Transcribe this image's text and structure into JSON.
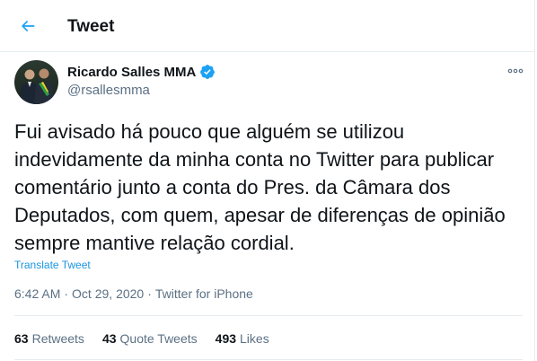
{
  "header": {
    "title": "Tweet",
    "back_icon": "arrow-left-icon"
  },
  "author": {
    "name": "Ricardo Salles MMA",
    "handle": "@rsallesmma",
    "verified_icon": "verified-badge-icon"
  },
  "tweet": {
    "text": "Fui avisado há pouco que alguém se utilizou indevidamente da minha conta no Twitter para publicar comentário junto a conta do Pres. da Câmara dos Deputados, com quem, apesar de diferenças de opinião sempre mantive relação cordial.",
    "translate": "Translate Tweet",
    "time": "6:42 AM",
    "date": "Oct 29, 2020",
    "separator": "·",
    "source": "Twitter for iPhone"
  },
  "stats": {
    "retweets_count": "63",
    "retweets_label": "Retweets",
    "quotes_count": "43",
    "quotes_label": "Quote Tweets",
    "likes_count": "493",
    "likes_label": "Likes"
  },
  "colors": {
    "accent": "#1da1f2",
    "link": "#1b95e0",
    "text": "#0f1419",
    "secondary": "#5b7083",
    "border": "#e6ecf0"
  }
}
